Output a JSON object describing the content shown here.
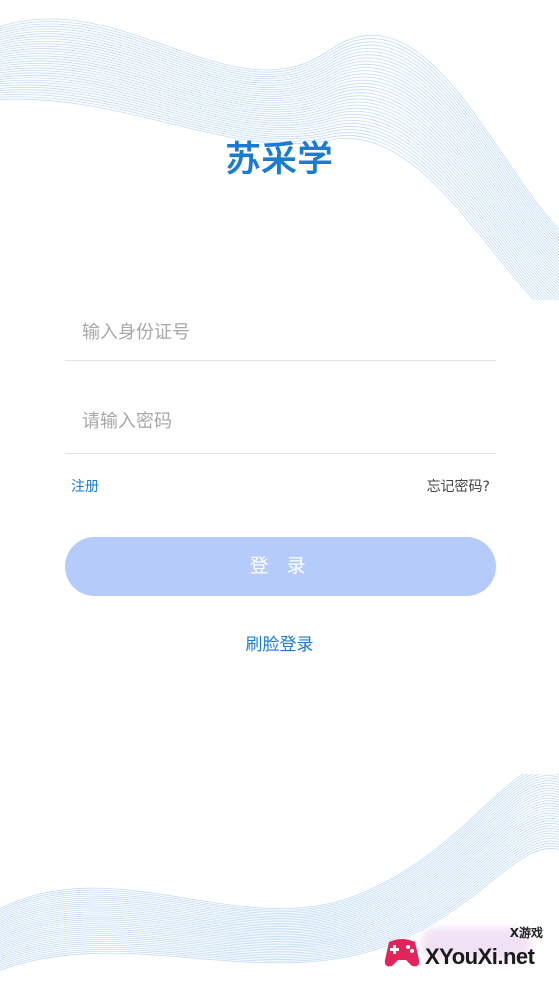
{
  "app": {
    "title": "苏采学"
  },
  "form": {
    "id_number": {
      "placeholder": "输入身份证号",
      "value": ""
    },
    "password": {
      "placeholder": "请输入密码",
      "value": ""
    },
    "register_label": "注册",
    "forgot_label": "忘记密码?",
    "login_label": "登 录",
    "face_login_label": "刷脸登录"
  },
  "watermark": {
    "small_text": "X游戏",
    "site_text": "XYouXi.net"
  },
  "colors": {
    "accent": "#1a7bd2",
    "button_bg": "#b5ccfb",
    "wave": "#bcd8f4"
  },
  "icons": {
    "top_decoration": "wave-lines",
    "bottom_decoration": "wave-lines",
    "watermark_logo": "gamepad-logo"
  }
}
